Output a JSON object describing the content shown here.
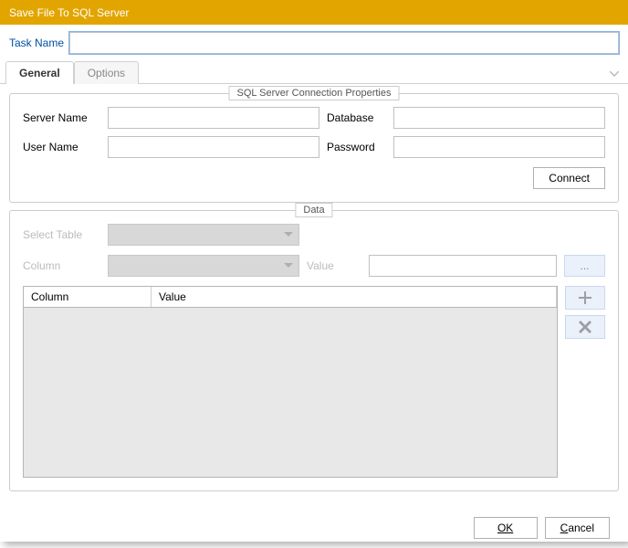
{
  "title": "Save File To SQL Server",
  "task_name_label": "Task Name",
  "task_name_value": "",
  "tabs": {
    "general": "General",
    "options": "Options"
  },
  "connection": {
    "legend": "SQL Server Connection Properties",
    "server_name_label": "Server Name",
    "server_name_value": "",
    "database_label": "Database",
    "database_value": "",
    "user_name_label": "User Name",
    "user_name_value": "",
    "password_label": "Password",
    "password_value": "",
    "connect_label": "Connect"
  },
  "data_section": {
    "legend": "Data",
    "select_table_label": "Select Table",
    "column_label": "Column",
    "value_label": "Value",
    "value_value": "",
    "ellipsis": "...",
    "table_headers": {
      "column": "Column",
      "value": "Value"
    }
  },
  "footer": {
    "ok": "OK",
    "cancel": "Cancel"
  }
}
